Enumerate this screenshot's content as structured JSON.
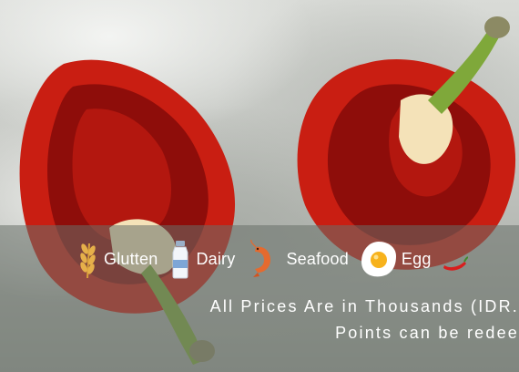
{
  "allergens": [
    {
      "icon": "wheat-icon",
      "label": "Glutten"
    },
    {
      "icon": "milk-bottle-icon",
      "label": "Dairy"
    },
    {
      "icon": "shrimp-icon",
      "label": "Seafood"
    },
    {
      "icon": "fried-egg-icon",
      "label": "Egg"
    },
    {
      "icon": "chili-pepper-icon",
      "label": ""
    }
  ],
  "notes": {
    "prices": "All Prices Are in Thousands (IDR.",
    "points": "Points can be redee"
  },
  "colors": {
    "pepper_red": "#d6281a",
    "stem_green": "#7fa83a",
    "strip": "#687068"
  }
}
